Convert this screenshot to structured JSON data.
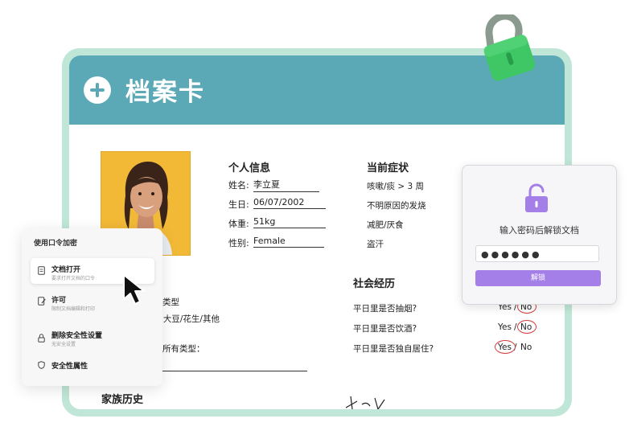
{
  "card": {
    "title": "档案卡",
    "personal": {
      "heading": "个人信息",
      "fields": [
        {
          "label": "姓名:",
          "value": "李立夏"
        },
        {
          "label": "生日:",
          "value": "06/07/2002"
        },
        {
          "label": "体重:",
          "value": "51kg"
        },
        {
          "label": "性别:",
          "value": "Female"
        }
      ]
    },
    "symptoms": {
      "heading": "当前症状",
      "items": [
        "咳嗽/痰 > 3 周",
        "不明原因的发烧",
        "减肥/厌食",
        "盗汗"
      ]
    },
    "allergy": {
      "line1": "类型",
      "line2": "'大豆/花生/其他",
      "line3": "所有类型："
    },
    "social": {
      "heading": "社会经历",
      "questions": [
        {
          "q": "平日里是否抽烟?",
          "yes": "Yes",
          "sep": "/",
          "no": "No",
          "circled": "no"
        },
        {
          "q": "平日里是否饮酒?",
          "yes": "Yes",
          "sep": "/",
          "no": "No",
          "circled": "no"
        },
        {
          "q": "平日里是否独自居住?",
          "yes": "Yes",
          "sep": "/",
          "no": "No",
          "circled": "yes"
        }
      ]
    },
    "family": {
      "heading": "家族历史"
    }
  },
  "lock_dialog": {
    "prompt": "输入密码后解锁文档",
    "password_mask": "●●●●●●",
    "unlock_label": "解锁",
    "icon": "unlock-icon"
  },
  "encrypt_panel": {
    "title": "使用口令加密",
    "items": [
      {
        "label": "文档打开",
        "sub": "要求打开文档的口令",
        "icon": "document-icon"
      },
      {
        "label": "许可",
        "sub": "限制文档编辑和打印",
        "icon": "edit-icon"
      },
      {
        "label": "删除安全性设置",
        "sub": "无安全设置",
        "icon": "lock-icon"
      },
      {
        "label": "安全性属性",
        "sub": "",
        "icon": "shield-icon"
      }
    ]
  },
  "colors": {
    "header": "#5ba9b6",
    "frame": "#bfe6d6",
    "accent": "#a57fe8",
    "padlock": "#3fc766",
    "mark": "#d83a3a"
  }
}
